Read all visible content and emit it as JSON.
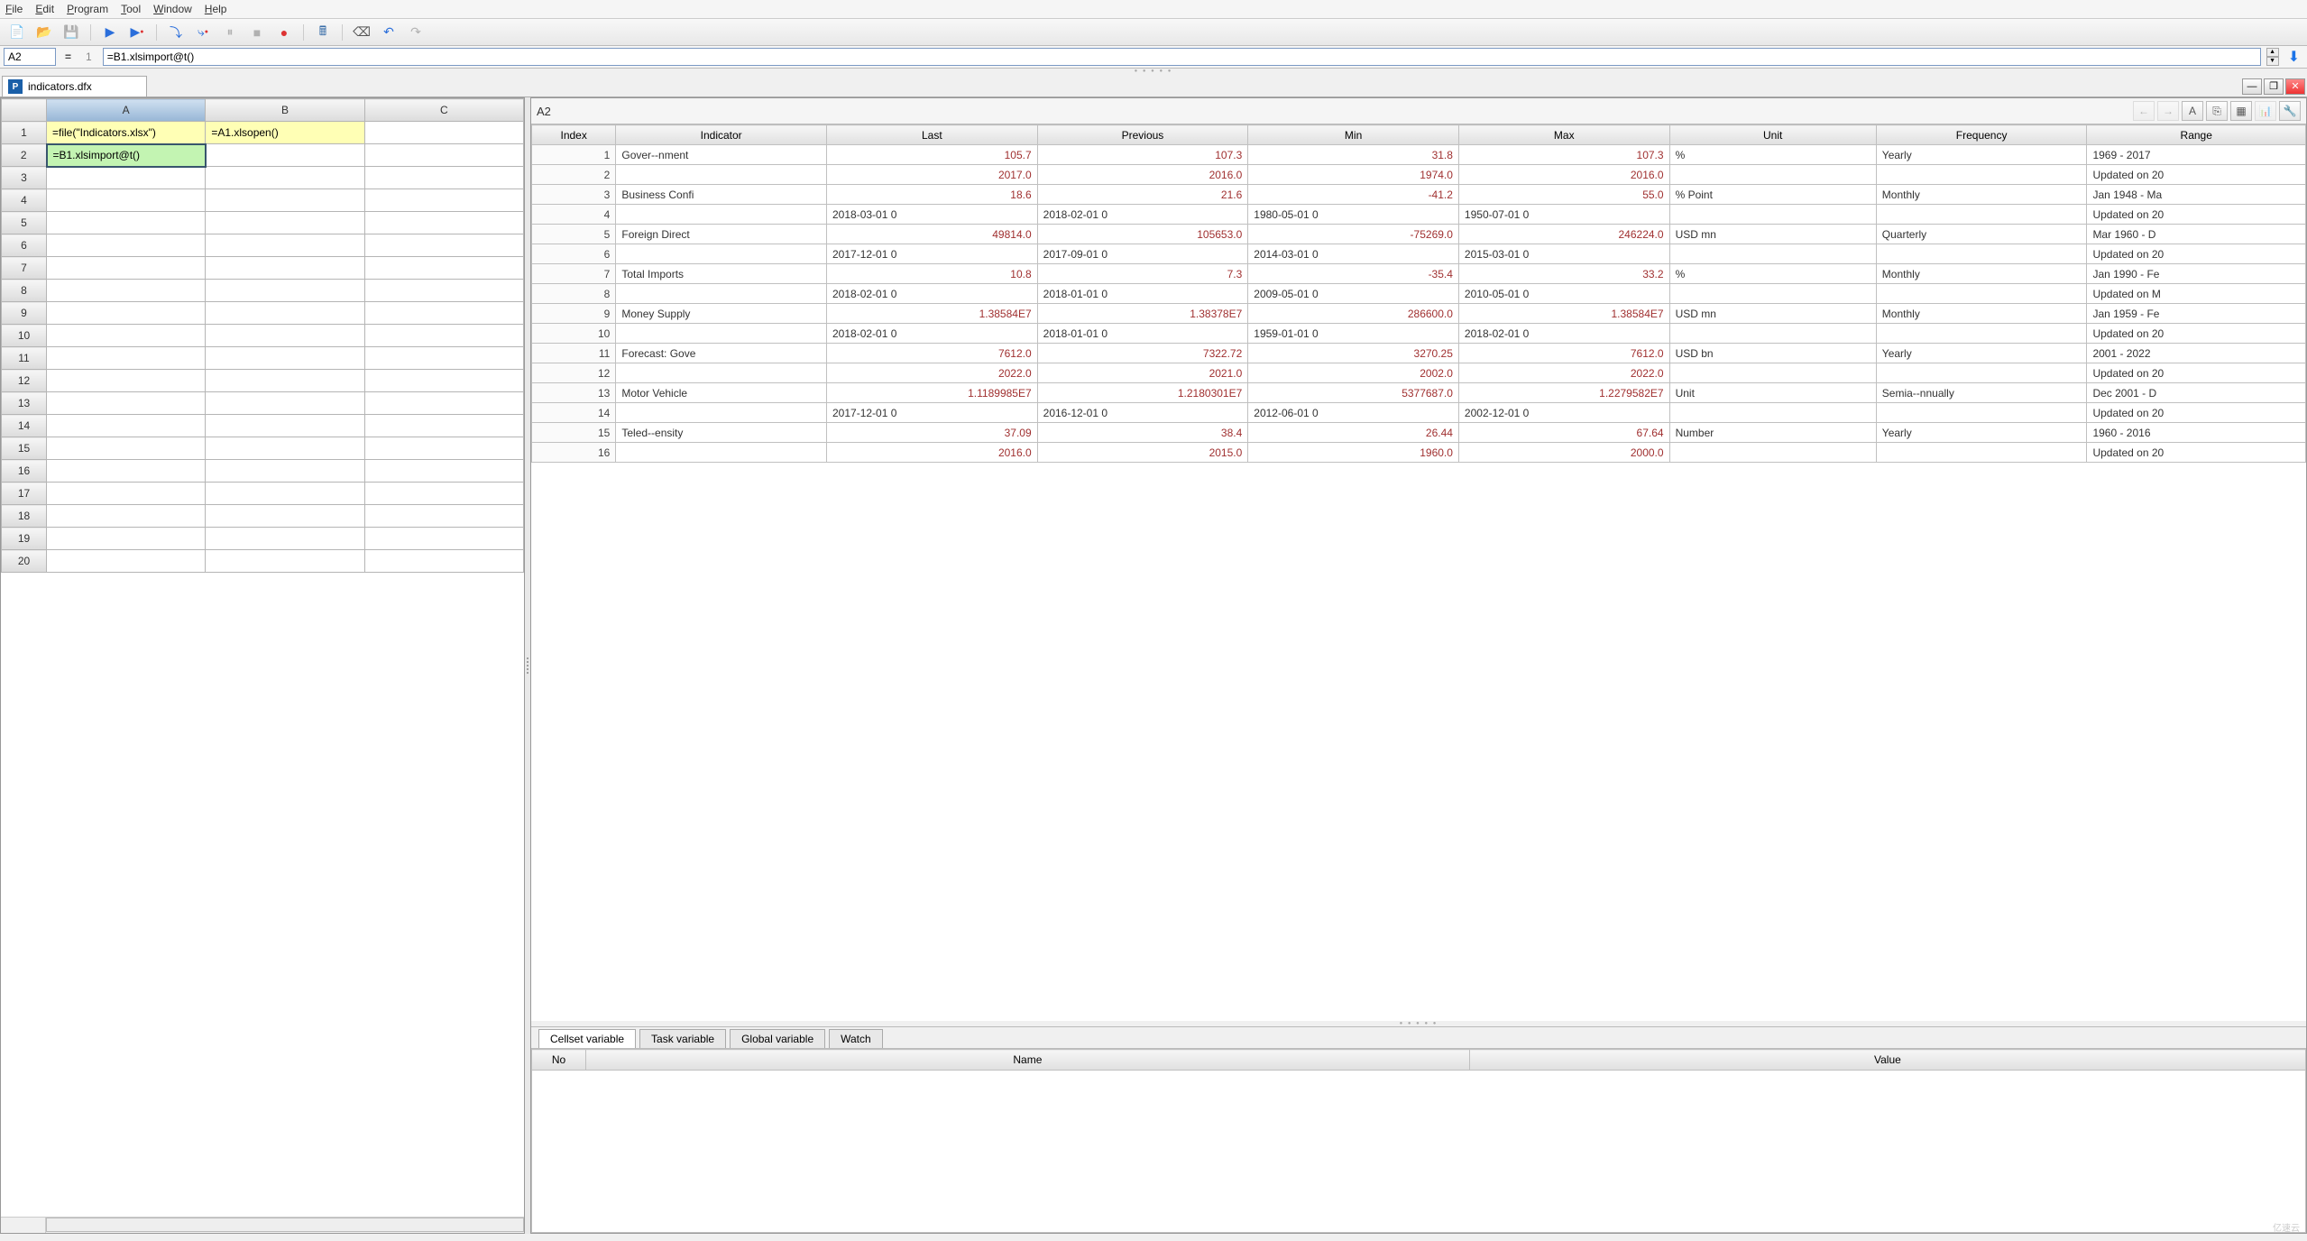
{
  "menu": {
    "file": "File",
    "edit": "Edit",
    "program": "Program",
    "tool": "Tool",
    "window": "Window",
    "help": "Help"
  },
  "formula_bar": {
    "cell_ref": "A2",
    "line": "1",
    "formula": "=B1.xlsimport@t()"
  },
  "doc_tab": {
    "name": "indicators.dfx"
  },
  "left_grid": {
    "cols": [
      "A",
      "B",
      "C"
    ],
    "rows": 20,
    "cells": {
      "A1": "=file(\"Indicators.xlsx\")",
      "B1": "=A1.xlsopen()",
      "A2": "=B1.xlsimport@t()"
    }
  },
  "right_panel": {
    "label": "A2"
  },
  "data_headers": [
    "Index",
    "Indicator",
    "Last",
    "Previous",
    "Min",
    "Max",
    "Unit",
    "Frequency",
    "Range"
  ],
  "data_rows": [
    {
      "idx": "1",
      "ind": "Gover--nment",
      "last": "105.7",
      "prev": "107.3",
      "min": "31.8",
      "max": "107.3",
      "unit": "%",
      "freq": "Yearly",
      "range": "1969 - 2017"
    },
    {
      "idx": "2",
      "ind": "",
      "last": "2017.0",
      "prev": "2016.0",
      "min": "1974.0",
      "max": "2016.0",
      "unit": "",
      "freq": "",
      "range": "Updated on 20"
    },
    {
      "idx": "3",
      "ind": "Business Confi",
      "last": "18.6",
      "prev": "21.6",
      "min": "-41.2",
      "max": "55.0",
      "unit": "% Point",
      "freq": "Monthly",
      "range": "Jan 1948 - Ma"
    },
    {
      "idx": "4",
      "ind": "",
      "last": "2018-03-01 0",
      "prev": "2018-02-01 0",
      "min": "1980-05-01 0",
      "max": "1950-07-01 0",
      "unit": "",
      "freq": "",
      "range": "Updated on 20"
    },
    {
      "idx": "5",
      "ind": "Foreign Direct",
      "last": "49814.0",
      "prev": "105653.0",
      "min": "-75269.0",
      "max": "246224.0",
      "unit": "USD mn",
      "freq": "Quarterly",
      "range": "Mar 1960 - D"
    },
    {
      "idx": "6",
      "ind": "",
      "last": "2017-12-01 0",
      "prev": "2017-09-01 0",
      "min": "2014-03-01 0",
      "max": "2015-03-01 0",
      "unit": "",
      "freq": "",
      "range": "Updated on 20"
    },
    {
      "idx": "7",
      "ind": "Total Imports",
      "last": "10.8",
      "prev": "7.3",
      "min": "-35.4",
      "max": "33.2",
      "unit": "%",
      "freq": "Monthly",
      "range": "Jan 1990 - Fe"
    },
    {
      "idx": "8",
      "ind": "",
      "last": "2018-02-01 0",
      "prev": "2018-01-01 0",
      "min": "2009-05-01 0",
      "max": "2010-05-01 0",
      "unit": "",
      "freq": "",
      "range": "Updated on M"
    },
    {
      "idx": "9",
      "ind": "Money Supply",
      "last": "1.38584E7",
      "prev": "1.38378E7",
      "min": "286600.0",
      "max": "1.38584E7",
      "unit": "USD mn",
      "freq": "Monthly",
      "range": "Jan 1959 - Fe"
    },
    {
      "idx": "10",
      "ind": "",
      "last": "2018-02-01 0",
      "prev": "2018-01-01 0",
      "min": "1959-01-01 0",
      "max": "2018-02-01 0",
      "unit": "",
      "freq": "",
      "range": "Updated on 20"
    },
    {
      "idx": "11",
      "ind": "Forecast: Gove",
      "last": "7612.0",
      "prev": "7322.72",
      "min": "3270.25",
      "max": "7612.0",
      "unit": "USD bn",
      "freq": "Yearly",
      "range": "2001 - 2022"
    },
    {
      "idx": "12",
      "ind": "",
      "last": "2022.0",
      "prev": "2021.0",
      "min": "2002.0",
      "max": "2022.0",
      "unit": "",
      "freq": "",
      "range": "Updated on 20"
    },
    {
      "idx": "13",
      "ind": "Motor Vehicle",
      "last": "1.1189985E7",
      "prev": "1.2180301E7",
      "min": "5377687.0",
      "max": "1.2279582E7",
      "unit": "Unit",
      "freq": "Semia--nnually",
      "range": "Dec 2001 - D"
    },
    {
      "idx": "14",
      "ind": "",
      "last": "2017-12-01 0",
      "prev": "2016-12-01 0",
      "min": "2012-06-01 0",
      "max": "2002-12-01 0",
      "unit": "",
      "freq": "",
      "range": "Updated on 20"
    },
    {
      "idx": "15",
      "ind": "Teled--ensity",
      "last": "37.09",
      "prev": "38.4",
      "min": "26.44",
      "max": "67.64",
      "unit": "Number",
      "freq": "Yearly",
      "range": "1960 - 2016"
    },
    {
      "idx": "16",
      "ind": "",
      "last": "2016.0",
      "prev": "2015.0",
      "min": "1960.0",
      "max": "2000.0",
      "unit": "",
      "freq": "",
      "range": "Updated on 20"
    }
  ],
  "var_tabs": [
    "Cellset variable",
    "Task variable",
    "Global variable",
    "Watch"
  ],
  "var_headers": [
    "No",
    "Name",
    "Value"
  ],
  "watermark": "亿速云"
}
